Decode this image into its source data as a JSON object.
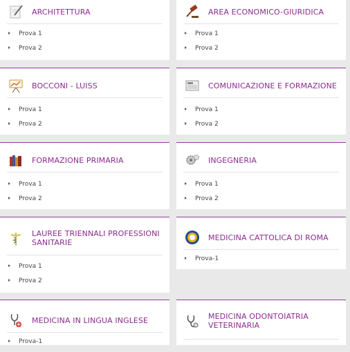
{
  "cards": [
    {
      "title": "ARCHITETTURA",
      "items": [
        "Prova 1",
        "Prova 2"
      ]
    },
    {
      "title": "AREA ECONOMICO-GIURIDICA",
      "items": [
        "Prova 1",
        "Prova 2"
      ]
    },
    {
      "title": "BOCCONI - LUISS",
      "items": [
        "Prova 1",
        "Prova 2"
      ]
    },
    {
      "title": "COMUNICAZIONE E FORMAZIONE",
      "items": [
        "Prova 1",
        "Prova 2"
      ]
    },
    {
      "title": "FORMAZIONE PRIMARIA",
      "items": [
        "Prova 1",
        "Prova 2"
      ]
    },
    {
      "title": "INGEGNERIA",
      "items": [
        "Prova 1",
        "Prova 2"
      ]
    },
    {
      "title": "LAUREE TRIENNALI PROFESSIONI SANITARIE",
      "items": [
        "Prova 1",
        "Prova 2"
      ]
    },
    {
      "title": "MEDICINA CATTOLICA DI ROMA",
      "items": [
        "Prova-1"
      ]
    },
    {
      "title": "MEDICINA IN LINGUA INGLESE",
      "items": [
        "Prova-1"
      ]
    },
    {
      "title": "MEDICINA ODONTOIATRIA VETERINARIA",
      "items": []
    }
  ],
  "icons": [
    "pencil-paper-icon",
    "gavel-icon",
    "presentation-board-icon",
    "newspaper-icon",
    "books-icon",
    "gears-icon",
    "caduceus-icon",
    "university-seal-icon",
    "stethoscope-flag-icon",
    "stethoscope-icon"
  ]
}
